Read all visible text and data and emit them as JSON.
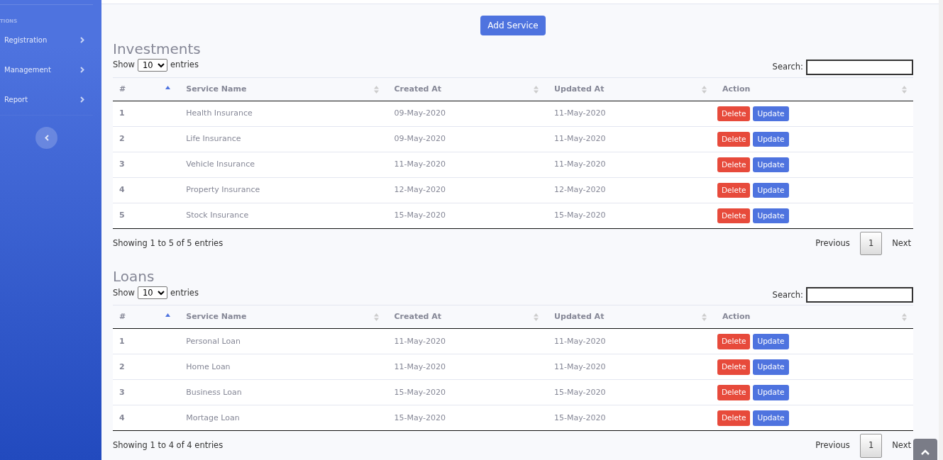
{
  "sidebar": {
    "heading": "TIONS",
    "items": [
      {
        "label": "Registration"
      },
      {
        "label": "Management"
      },
      {
        "label": "Report"
      }
    ]
  },
  "add_button": "Add Service",
  "sections": [
    {
      "title": "Investments",
      "show_label": "Show",
      "length_value": "10",
      "entries_label": "entries",
      "search_label": "Search:",
      "columns": [
        {
          "label": "#",
          "sorted": true
        },
        {
          "label": "Service Name",
          "sorted": false
        },
        {
          "label": "Created At",
          "sorted": false
        },
        {
          "label": "Updated At",
          "sorted": false
        },
        {
          "label": "Action",
          "sorted": false
        }
      ],
      "rows": [
        {
          "cells": [
            "1",
            "Health Insurance",
            "09-May-2020",
            "11-May-2020"
          ],
          "actions": [
            "Delete",
            "Update"
          ]
        },
        {
          "cells": [
            "2",
            "Life Insurance",
            "09-May-2020",
            "11-May-2020"
          ],
          "actions": [
            "Delete",
            "Update"
          ]
        },
        {
          "cells": [
            "3",
            "Vehicle Insurance",
            "11-May-2020",
            "11-May-2020"
          ],
          "actions": [
            "Delete",
            "Update"
          ]
        },
        {
          "cells": [
            "4",
            "Property Insurance",
            "12-May-2020",
            "12-May-2020"
          ],
          "actions": [
            "Delete",
            "Update"
          ]
        },
        {
          "cells": [
            "5",
            "Stock Insurance",
            "15-May-2020",
            "15-May-2020"
          ],
          "actions": [
            "Delete",
            "Update"
          ]
        }
      ],
      "info": "Showing 1 to 5 of 5 entries",
      "pagination": [
        {
          "label": "Previous",
          "selected": false
        },
        {
          "label": "1",
          "selected": true
        },
        {
          "label": "Next",
          "selected": false
        }
      ]
    },
    {
      "title": "Loans",
      "show_label": "Show",
      "length_value": "10",
      "entries_label": "entries",
      "search_label": "Search:",
      "columns": [
        {
          "label": "#",
          "sorted": true
        },
        {
          "label": "Service Name",
          "sorted": false
        },
        {
          "label": "Created At",
          "sorted": false
        },
        {
          "label": "Updated At",
          "sorted": false
        },
        {
          "label": "Action",
          "sorted": false
        }
      ],
      "rows": [
        {
          "cells": [
            "1",
            "Personal Loan",
            "11-May-2020",
            "11-May-2020"
          ],
          "actions": [
            "Delete",
            "Update"
          ]
        },
        {
          "cells": [
            "2",
            "Home Loan",
            "11-May-2020",
            "11-May-2020"
          ],
          "actions": [
            "Delete",
            "Update"
          ]
        },
        {
          "cells": [
            "3",
            "Business Loan",
            "15-May-2020",
            "15-May-2020"
          ],
          "actions": [
            "Delete",
            "Update"
          ]
        },
        {
          "cells": [
            "4",
            "Mortage Loan",
            "15-May-2020",
            "15-May-2020"
          ],
          "actions": [
            "Delete",
            "Update"
          ]
        }
      ],
      "info": "Showing 1 to 4 of 4 entries",
      "pagination": [
        {
          "label": "Previous",
          "selected": false
        },
        {
          "label": "1",
          "selected": true
        },
        {
          "label": "Next",
          "selected": false
        }
      ]
    }
  ]
}
